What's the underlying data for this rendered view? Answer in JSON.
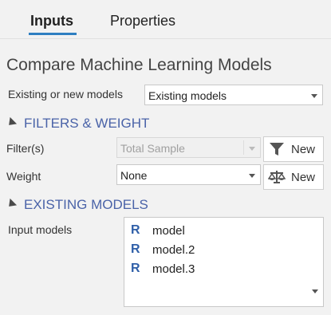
{
  "tabs": [
    {
      "label": "Inputs",
      "active": true
    },
    {
      "label": "Properties",
      "active": false
    }
  ],
  "title": "Compare Machine Learning Models",
  "existing_or_new": {
    "label": "Existing or new models",
    "value": "Existing models"
  },
  "filters_weight": {
    "header": "FILTERS & WEIGHT",
    "filter": {
      "label": "Filter(s)",
      "value": "Total Sample",
      "disabled": true,
      "button": "New",
      "icon": "filter-funnel-icon"
    },
    "weight": {
      "label": "Weight",
      "value": "None",
      "button": "New",
      "icon": "balance-scale-icon"
    }
  },
  "existing_models": {
    "header": "EXISTING MODELS",
    "input_label": "Input models",
    "icon_letter": "R",
    "items": [
      "model",
      "model.2",
      "model.3"
    ]
  },
  "colors": {
    "accent": "#2f7fc1",
    "section": "#4a63a8",
    "r_icon": "#2f5fa8"
  }
}
